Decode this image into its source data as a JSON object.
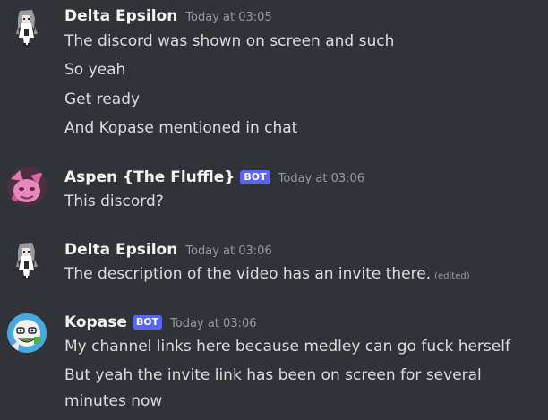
{
  "messages": [
    {
      "author": "Delta Epsilon",
      "timestamp": "Today at 03:05",
      "avatar_icon": "anime-girl-avatar",
      "lines": [
        "The discord was shown on screen and such",
        "So yeah",
        "Get ready",
        "And Kopase mentioned in chat"
      ]
    },
    {
      "author": "Aspen {The Fluffle}",
      "badge": "BOT",
      "timestamp": "Today at 03:06",
      "avatar_icon": "pink-fox-avatar",
      "lines": [
        "This discord?"
      ]
    },
    {
      "author": "Delta Epsilon",
      "timestamp": "Today at 03:06",
      "avatar_icon": "anime-girl-avatar",
      "lines": [
        "The description of the video has an invite there."
      ],
      "edited_label": "(edited)"
    },
    {
      "author": "Kopase",
      "badge": "BOT",
      "timestamp": "Today at 03:06",
      "avatar_icon": "cartoon-face-avatar",
      "lines": [
        "My channel links here because medley can go fuck herself",
        "But yeah the invite link has been on screen for several",
        "minutes now"
      ]
    }
  ],
  "colors": {
    "background": "#313338",
    "text": "#dbdee1",
    "username": "#f2f3f5",
    "timestamp": "#949ba4",
    "bot_badge": "#5865f2"
  }
}
